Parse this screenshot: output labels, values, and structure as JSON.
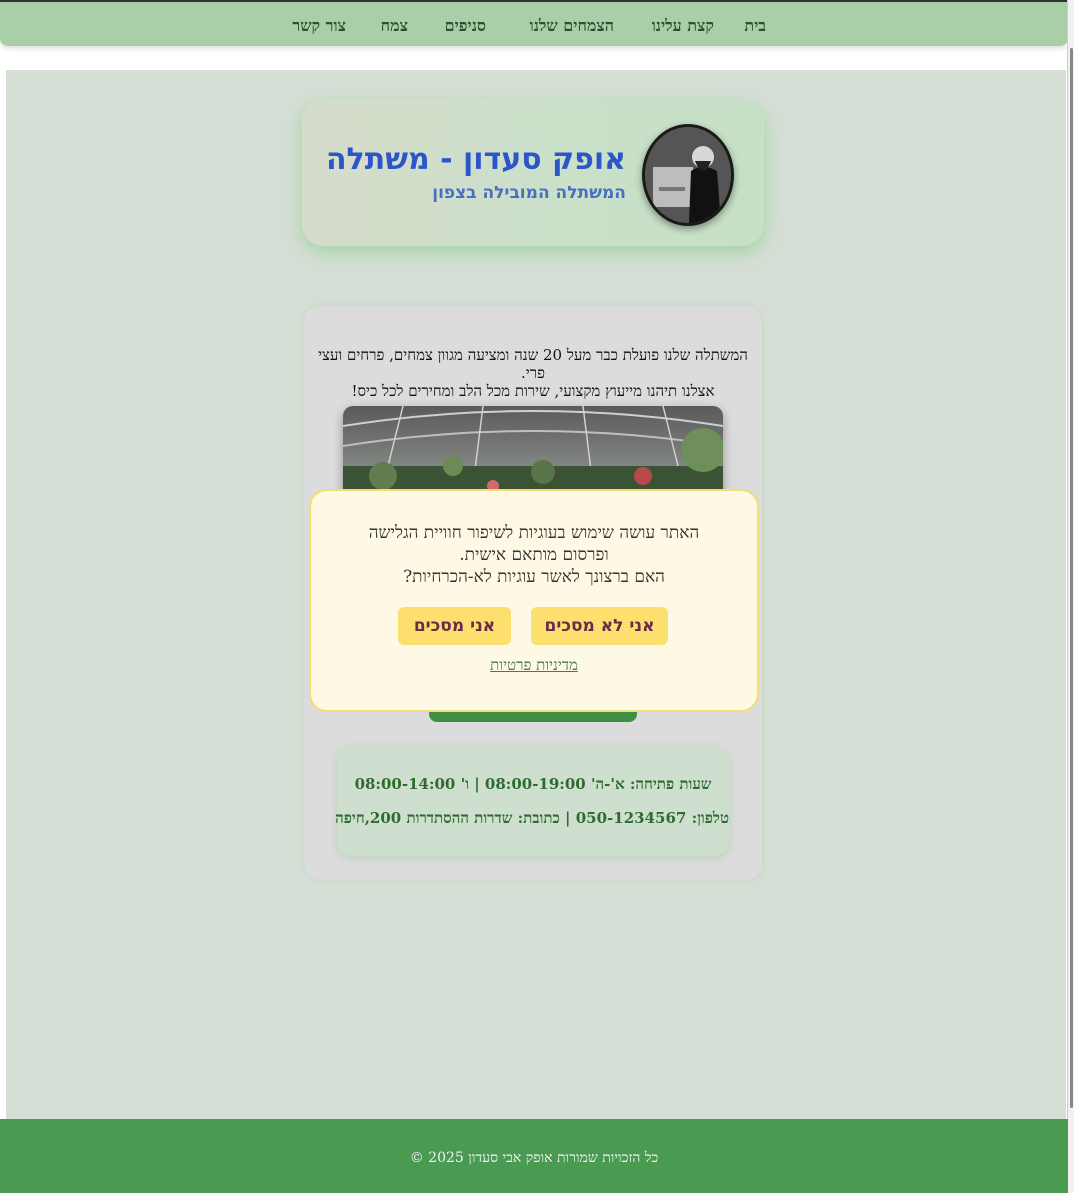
{
  "nav": {
    "items": [
      {
        "label": "בית"
      },
      {
        "label": "קצת עלינו"
      },
      {
        "label": "הצמחים שלנו"
      },
      {
        "label": "סניפים"
      },
      {
        "label": "צמח"
      },
      {
        "label": "צור קשר"
      }
    ]
  },
  "header": {
    "title": "אופק סעדון - משתלה",
    "subtitle": "המשתלה המובילה בצפון"
  },
  "intro": {
    "line1": "המשתלה שלנו פועלת כבר מעל 20 שנה ומציעה מגוון צמחים, פרחים ועצי פרי.",
    "line2": "אצלנו תיהנו מייעוץ מקצועי, שירות מכל הלב ומחירים לכל כיס!"
  },
  "info": {
    "hours": "שעות פתיחה: א'-ה' 08:00-19:00 | ו' 08:00-14:00",
    "contact": "טלפון: 050-1234567 | כתובת: שדרות ההסתדרות 200,חיפה"
  },
  "cookie_banner": {
    "line1": "האתר עושה שימוש בעוגיות לשיפור חוויית הגלישה",
    "line2": "ופרסום מותאם אישית.",
    "line3": "האם ברצונך לאשר עוגיות לא-הכרחיות?",
    "decline_label": "אני לא מסכים",
    "accept_label": "אני מסכים",
    "privacy_link": "מדיניות פרטיות"
  },
  "footer": {
    "text": "כל הזכויות שמורות אופק אבי סעדון 2025 ©"
  },
  "colors": {
    "nav_bg": "#a9cfa9",
    "title": "#2b55c8",
    "accent_green": "#3e8e46",
    "footer_bg": "#4a9a52",
    "cookie_button": "#fcdf6e"
  }
}
